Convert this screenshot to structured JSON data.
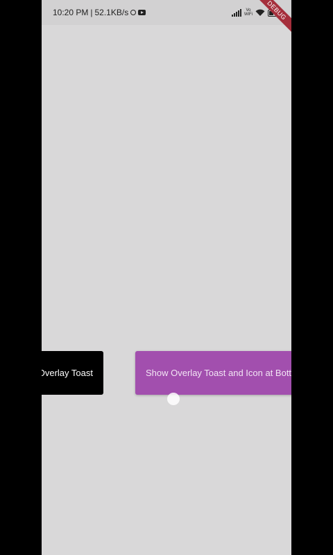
{
  "status_bar": {
    "time": "10:20 PM",
    "separator": "|",
    "net_speed": "52.1KB/s",
    "left_icons": [
      "whatsapp-icon",
      "youtube-icon"
    ],
    "right_icons": [
      "signal-icon",
      "volte-wifi-icon",
      "wifi-icon",
      "battery-icon"
    ],
    "volte_label": "Vo WiFi",
    "battery_level": "35"
  },
  "debug_banner": {
    "label": "DEBUG",
    "color": "#a52f3c"
  },
  "toast": {
    "text": "Overlay Toast",
    "background": "#000000"
  },
  "button": {
    "label": "Show Overlay Toast and Icon at Bottom",
    "background": "#a24fae"
  },
  "colors": {
    "screen_background": "#d9d8d9",
    "status_bar_background": "#d2d1d2"
  }
}
